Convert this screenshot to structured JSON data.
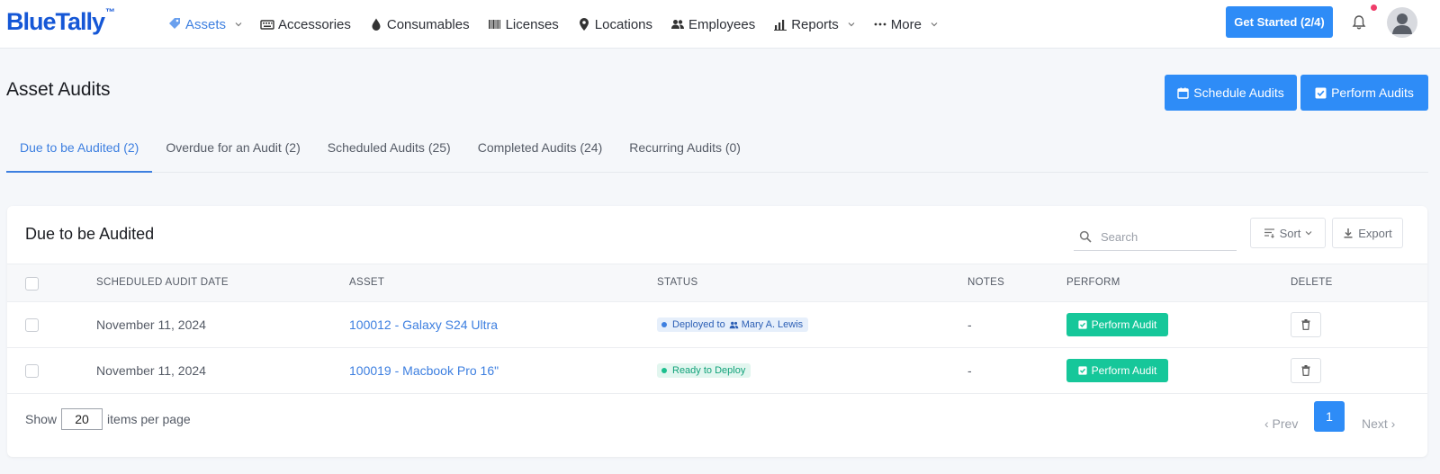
{
  "app": {
    "name": "BlueTally",
    "tm": "™"
  },
  "nav": {
    "items": [
      {
        "label": "Assets",
        "icon": "tag-icon",
        "active": true,
        "has_dropdown": true
      },
      {
        "label": "Accessories",
        "icon": "keyboard-icon"
      },
      {
        "label": "Consumables",
        "icon": "drop-icon"
      },
      {
        "label": "Licenses",
        "icon": "barcode-icon"
      },
      {
        "label": "Locations",
        "icon": "map-pin-icon"
      },
      {
        "label": "Employees",
        "icon": "users-icon"
      },
      {
        "label": "Reports",
        "icon": "bar-chart-icon",
        "has_dropdown": true
      },
      {
        "label": "More",
        "icon": "ellipsis-icon",
        "has_dropdown": true
      }
    ],
    "get_started": "Get Started (2/4)"
  },
  "page": {
    "title": "Asset Audits",
    "schedule_button": "Schedule Audits",
    "perform_button": "Perform Audits"
  },
  "tabs": [
    {
      "label": "Due to be Audited (2)",
      "active": true
    },
    {
      "label": "Overdue for an Audit (2)"
    },
    {
      "label": "Scheduled Audits (25)"
    },
    {
      "label": "Completed Audits (24)"
    },
    {
      "label": "Recurring Audits (0)"
    }
  ],
  "card": {
    "title": "Due to be Audited",
    "search_placeholder": "Search",
    "sort_label": "Sort",
    "export_label": "Export"
  },
  "table": {
    "headers": {
      "date": "SCHEDULED AUDIT DATE",
      "asset": "ASSET",
      "status": "STATUS",
      "notes": "NOTES",
      "perform": "PERFORM",
      "delete": "DELETE"
    },
    "rows": [
      {
        "date": "November 11, 2024",
        "asset": "100012 - Galaxy S24 Ultra",
        "status_prefix": "Deployed to",
        "status_person": "Mary A. Lewis",
        "status_type": "deployed",
        "notes": "-",
        "perform_label": "Perform Audit"
      },
      {
        "date": "November 11, 2024",
        "asset": "100019 - Macbook Pro 16\"",
        "status_prefix": "Ready to Deploy",
        "status_type": "ready",
        "notes": "-",
        "perform_label": "Perform Audit"
      }
    ]
  },
  "footer": {
    "show_label": "Show",
    "per_page": "20",
    "per_page_suffix": "items per page",
    "prev": "‹ Prev",
    "current_page": "1",
    "next": "Next ›"
  },
  "colors": {
    "brand": "#1557d6",
    "primary": "#2e8cf7",
    "success": "#16c79a",
    "notification": "#ef3d6a"
  }
}
